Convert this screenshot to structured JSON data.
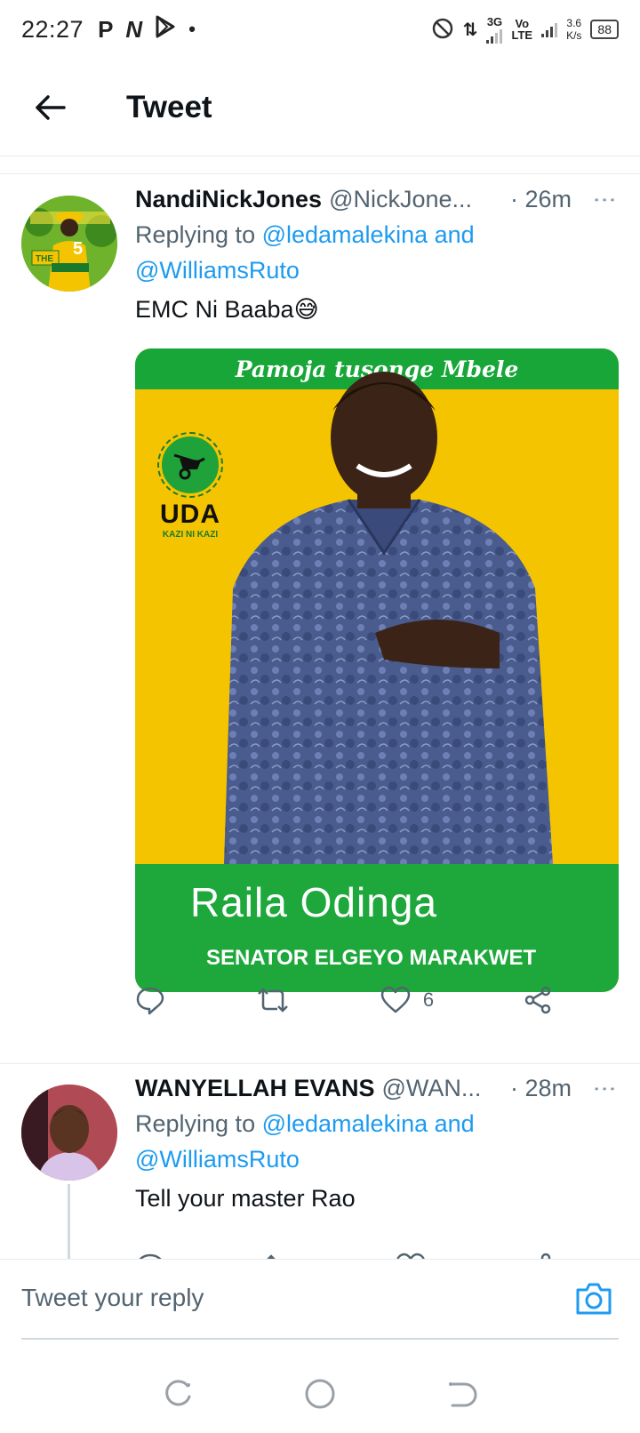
{
  "status_bar": {
    "time": "22:27",
    "left_icons": [
      "P",
      "N",
      "play-store-icon",
      "•"
    ],
    "network_1": "3G",
    "network_2_top": "Vo",
    "network_2_bottom": "LTE",
    "speed_value": "3.6",
    "speed_unit": "K/s",
    "battery": "88"
  },
  "header": {
    "title": "Tweet"
  },
  "tweets": [
    {
      "display_name": "NandiNickJones",
      "handle": "@NickJone...",
      "time": "· 26m",
      "replying_prefix": "Replying to ",
      "mention_1": "@ledamalekina",
      "mention_join": " and",
      "mention_2": "@WilliamsRuto",
      "text": "EMC Ni Baaba😅",
      "media": {
        "slogan": "Pamoja tusonge Mbele",
        "logo_text": "UDA",
        "logo_sub": "KAZI NI KAZI",
        "name": "Raila Odinga",
        "role": "SENATOR ELGEYO MARAKWET"
      },
      "likes": "6"
    },
    {
      "display_name": "WANYELLAH EVANS",
      "handle": "@WAN...",
      "time": "· 28m",
      "replying_prefix": "Replying to ",
      "mention_1": "@ledamalekina",
      "mention_join": " and",
      "mention_2": "@WilliamsRuto",
      "text": "Tell your master Rao"
    }
  ],
  "composer": {
    "placeholder": "Tweet your reply"
  },
  "colors": {
    "accent": "#1d9bf0",
    "secondary_text": "#536471",
    "uda_yellow": "#f5c400",
    "uda_green": "#1ea83c"
  }
}
